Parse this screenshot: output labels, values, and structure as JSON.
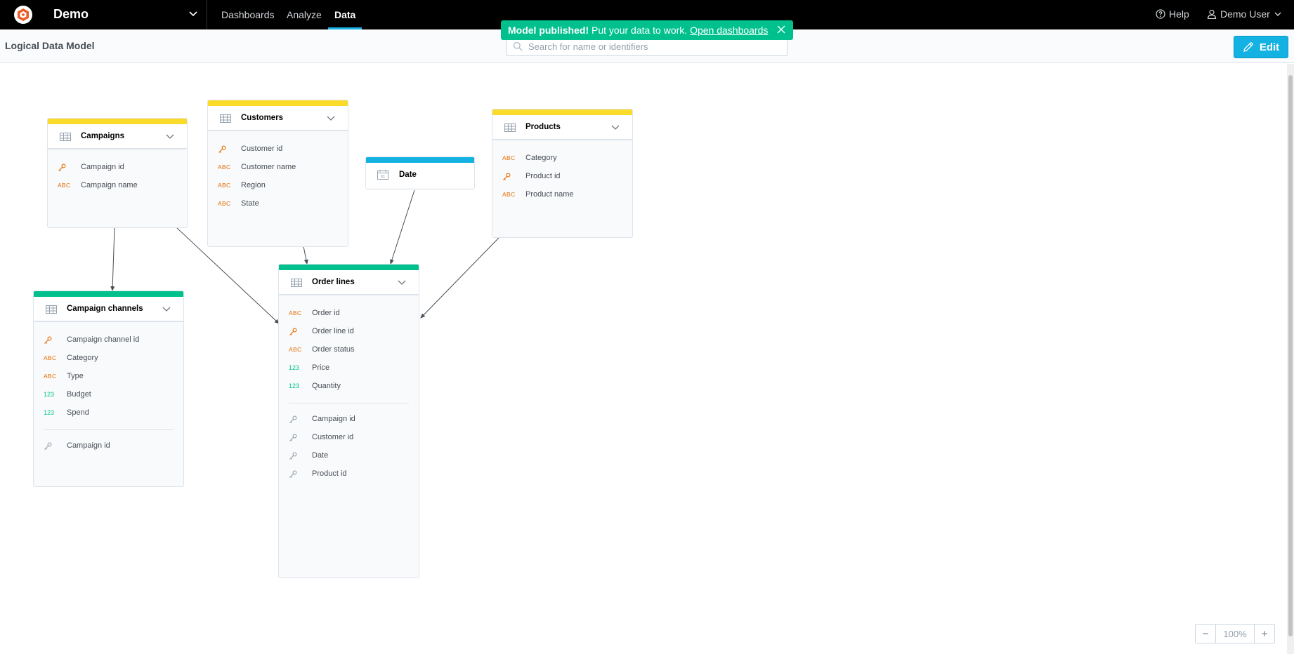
{
  "header": {
    "workspace": "Demo",
    "nav": [
      {
        "label": "Dashboards",
        "active": false
      },
      {
        "label": "Analyze",
        "active": false
      },
      {
        "label": "Data",
        "active": true
      }
    ],
    "help_label": "Help",
    "user_label": "Demo User"
  },
  "subheader": {
    "title": "Logical Data Model",
    "search_placeholder": "Search for name or identifiers",
    "edit_label": "Edit"
  },
  "toast": {
    "bold": "Model published!",
    "message": " Put your data to work. ",
    "link": "Open dashboards"
  },
  "colors": {
    "accent": "#14b2e2",
    "success": "#00c18d",
    "dataset_attribute": "#fbdb29",
    "dataset_fact": "#00c18d",
    "dataset_date": "#14b2e2"
  },
  "datasets": {
    "campaigns": {
      "title": "Campaigns",
      "fields": [
        {
          "type": "key",
          "label": "Campaign id"
        },
        {
          "type": "abc",
          "label": "Campaign name"
        }
      ]
    },
    "customers": {
      "title": "Customers",
      "fields": [
        {
          "type": "key",
          "label": "Customer id"
        },
        {
          "type": "abc",
          "label": "Customer name"
        },
        {
          "type": "abc",
          "label": "Region"
        },
        {
          "type": "abc",
          "label": "State"
        }
      ]
    },
    "date": {
      "title": "Date"
    },
    "products": {
      "title": "Products",
      "fields": [
        {
          "type": "abc",
          "label": "Category"
        },
        {
          "type": "key",
          "label": "Product id"
        },
        {
          "type": "abc",
          "label": "Product name"
        }
      ]
    },
    "order_lines": {
      "title": "Order lines",
      "fields": [
        {
          "type": "abc",
          "label": "Order id"
        },
        {
          "type": "key",
          "label": "Order line id"
        },
        {
          "type": "abc",
          "label": "Order status"
        },
        {
          "type": "num",
          "label": "Price"
        },
        {
          "type": "num",
          "label": "Quantity"
        }
      ],
      "references": [
        {
          "type": "ref",
          "label": "Campaign id"
        },
        {
          "type": "ref",
          "label": "Customer id"
        },
        {
          "type": "ref",
          "label": "Date"
        },
        {
          "type": "ref",
          "label": "Product id"
        }
      ]
    },
    "campaign_channels": {
      "title": "Campaign channels",
      "fields": [
        {
          "type": "key",
          "label": "Campaign channel id"
        },
        {
          "type": "abc",
          "label": "Category"
        },
        {
          "type": "abc",
          "label": "Type"
        },
        {
          "type": "num",
          "label": "Budget"
        },
        {
          "type": "num",
          "label": "Spend"
        }
      ],
      "references": [
        {
          "type": "ref",
          "label": "Campaign id"
        }
      ]
    }
  },
  "type_badges": {
    "abc": "ABC",
    "num": "123"
  },
  "zoom": {
    "minus": "−",
    "value": "100%",
    "plus": "+"
  }
}
